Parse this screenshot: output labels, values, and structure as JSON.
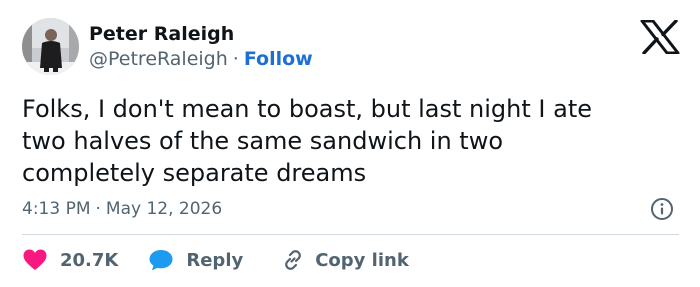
{
  "tweet": {
    "author_name": "Peter Raleigh",
    "handle": "@PetreRaleigh",
    "separator": "·",
    "follow_label": "Follow",
    "text": "Folks, I don't mean to boast, but last night I ate\ntwo halves of the same sandwich in two\ncompletely separate dreams",
    "time": "4:13 PM",
    "date": "May 12, 2026",
    "icons": {
      "platform": "x-logo-icon",
      "info": "info-icon",
      "like": "heart-icon",
      "reply": "reply-bubble-icon",
      "copy": "link-icon"
    }
  },
  "actions": {
    "like_count": "20.7K",
    "reply_label": "Reply",
    "copy_label": "Copy link"
  },
  "colors": {
    "heart": "#f91880",
    "reply": "#1d9bf0",
    "follow": "#1d6fd6",
    "secondary_text": "#536471",
    "divider": "#cfd9de"
  }
}
